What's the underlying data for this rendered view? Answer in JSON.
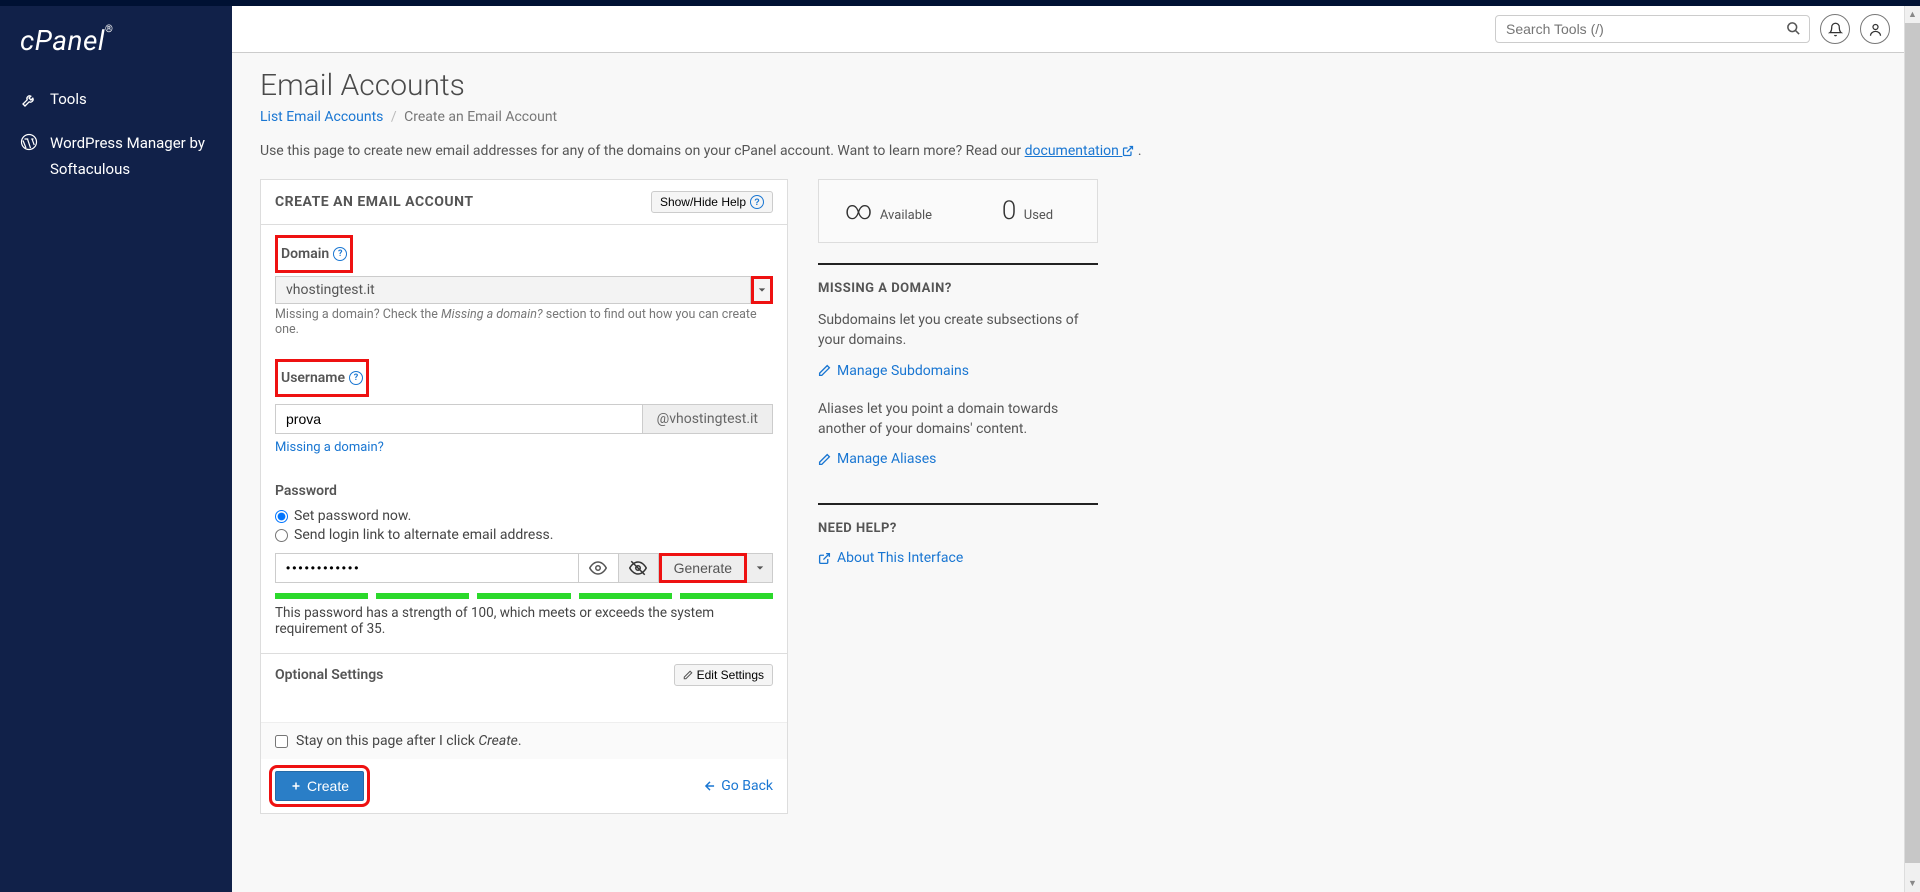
{
  "sidebar": {
    "logo_text": "cPanel",
    "items": [
      {
        "label": "Tools",
        "icon": "wrench"
      },
      {
        "label": "WordPress Manager by Softaculous",
        "icon": "wordpress"
      }
    ]
  },
  "header": {
    "search_placeholder": "Search Tools (/)"
  },
  "page": {
    "title": "Email Accounts",
    "breadcrumb_link": "List Email Accounts",
    "breadcrumb_current": "Create an Email Account",
    "description_pre": "Use this page to create new email addresses for any of the domains on your cPanel account. Want to learn more? Read our ",
    "description_link": "documentation",
    "description_post": " ."
  },
  "form": {
    "panel_title": "CREATE AN EMAIL ACCOUNT",
    "help_btn": "Show/Hide Help",
    "domain_label": "Domain",
    "domain_value": "vhostingtest.it",
    "domain_hint_pre": "Missing a domain? Check the ",
    "domain_hint_em": "Missing a domain?",
    "domain_hint_post": " section to find out how you can create one.",
    "username_label": "Username",
    "username_value": "prova",
    "username_addon": "@vhostingtest.it",
    "username_link": "Missing a domain?",
    "password_label": "Password",
    "pw_radio1": "Set password now.",
    "pw_radio2": "Send login link to alternate email address.",
    "pw_value": "••••••••••••",
    "generate_label": "Generate",
    "strength_text": "This password has a strength of 100, which meets or exceeds the system requirement of 35.",
    "optional_title": "Optional Settings",
    "edit_settings_btn": "Edit Settings",
    "stayon_pre": "Stay on this page after I click ",
    "stayon_em": "Create",
    "stayon_post": ".",
    "create_btn": "Create",
    "goback": "Go Back"
  },
  "side": {
    "available_val": "∞",
    "available_label": "Available",
    "used_val": "0",
    "used_label": "Used",
    "missing_title": "MISSING A DOMAIN?",
    "sub_p": "Subdomains let you create subsections of your domains.",
    "sub_link": "Manage Subdomains",
    "alias_p": "Aliases let you point a domain towards another of your domains' content.",
    "alias_link": "Manage Aliases",
    "help_title": "NEED HELP?",
    "help_link": "About This Interface"
  }
}
